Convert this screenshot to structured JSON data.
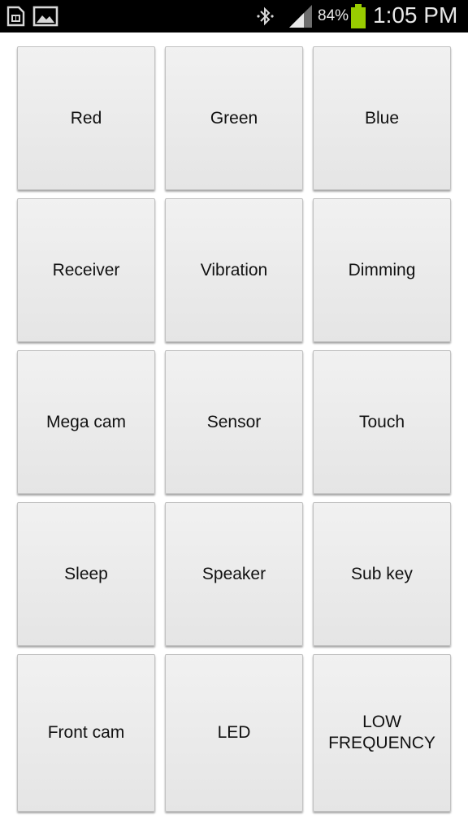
{
  "status_bar": {
    "battery_percent": "84%",
    "time": "1:05 PM",
    "battery_color": "#99cc00",
    "icons": [
      "sim-card-icon",
      "picture-icon",
      "bluetooth-icon",
      "signal-icon",
      "battery-icon"
    ]
  },
  "buttons": [
    {
      "label": "Red"
    },
    {
      "label": "Green"
    },
    {
      "label": "Blue"
    },
    {
      "label": "Receiver"
    },
    {
      "label": "Vibration"
    },
    {
      "label": "Dimming"
    },
    {
      "label": "Mega cam"
    },
    {
      "label": "Sensor"
    },
    {
      "label": "Touch"
    },
    {
      "label": "Sleep"
    },
    {
      "label": "Speaker"
    },
    {
      "label": "Sub key"
    },
    {
      "label": "Front cam"
    },
    {
      "label": "LED"
    },
    {
      "label": "LOW\nFREQUENCY"
    }
  ]
}
